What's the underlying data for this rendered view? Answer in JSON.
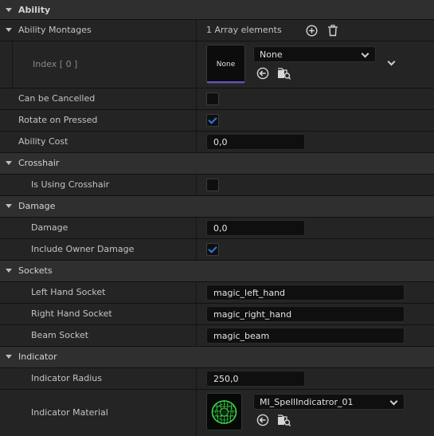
{
  "sections": {
    "ability": "Ability",
    "crosshair": "Crosshair",
    "damage": "Damage",
    "sockets": "Sockets",
    "indicator": "Indicator"
  },
  "ability_montages": {
    "label": "Ability Montages",
    "count": "1 Array elements",
    "index_label": "Index [ 0 ]",
    "thumb_text": "None",
    "value": "None"
  },
  "can_be_cancelled": {
    "label": "Can be Cancelled",
    "checked": false
  },
  "rotate_on_pressed": {
    "label": "Rotate on Pressed",
    "checked": true
  },
  "ability_cost": {
    "label": "Ability Cost",
    "value": "0,0"
  },
  "is_using_crosshair": {
    "label": "Is Using Crosshair",
    "checked": false
  },
  "damage": {
    "label": "Damage",
    "value": "0,0"
  },
  "include_owner_damage": {
    "label": "Include Owner Damage",
    "checked": true
  },
  "left_hand_socket": {
    "label": "Left Hand Socket",
    "value": "magic_left_hand"
  },
  "right_hand_socket": {
    "label": "Right Hand Socket",
    "value": "magic_right_hand"
  },
  "beam_socket": {
    "label": "Beam Socket",
    "value": "magic_beam"
  },
  "indicator_radius": {
    "label": "Indicator Radius",
    "value": "250,0"
  },
  "indicator_material": {
    "label": "Indicator Material",
    "value": "MI_SpellIndicatror_01"
  },
  "colors": {
    "accent": "#2d7bd8",
    "thumb_underline": "#6a4fc9",
    "material_green": "#39d84a"
  },
  "icons": [
    "collapse-arrow-icon",
    "add-element-icon",
    "delete-all-icon",
    "browse-to-asset-icon",
    "use-selected-asset-icon",
    "chevron-down-icon"
  ]
}
